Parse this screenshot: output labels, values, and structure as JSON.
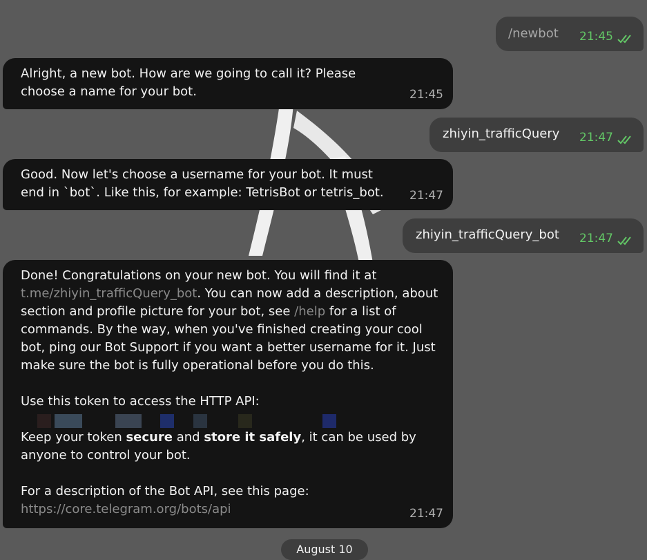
{
  "messages": [
    {
      "text": "/newbot",
      "time": "21:45"
    },
    {
      "text": "Alright, a new bot. How are we going to call it? Please choose a name for your bot.",
      "time": "21:45"
    },
    {
      "text": "zhiyin_trafficQuery",
      "time": "21:47"
    },
    {
      "text": "Good. Now let's choose a username for your bot. It must end in `bot`. Like this, for example: TetrisBot or tetris_bot.",
      "time": "21:47"
    },
    {
      "text": "zhiyin_trafficQuery_bot",
      "time": "21:47"
    },
    {
      "p1_a": "Done! Congratulations on your new bot. You will find it at",
      "p1_link": "t.me/zhiyin_trafficQuery_bot",
      "p1_b": ". You can now add a description, about section and profile picture for your bot, see",
      "p1_help": "/help",
      "p1_c": "for a list of commands. By the way, when you've finished creating your cool bot, ping our Bot Support if you want a better username for it. Just make sure the bot is fully operational before you do this.",
      "p2": "Use this token to access the HTTP API:",
      "p3_a": "Keep your token",
      "p3_b1": "secure",
      "p3_and": "and",
      "p3_b2": "store it safely",
      "p3_c": ", it can be used by anyone to control your bot.",
      "p4": "For a description of the Bot API, see this page:",
      "p4_link": "https://core.telegram.org/bots/api",
      "time": "21:47"
    }
  ],
  "date_pill": "August 10",
  "colors": {
    "outgoing_bubble": "#3e3e3e",
    "incoming_bubble": "#141414",
    "read_check": "#63c766",
    "link": "#8a8a8a"
  },
  "icons": {
    "read_receipt": "double-check-icon"
  }
}
